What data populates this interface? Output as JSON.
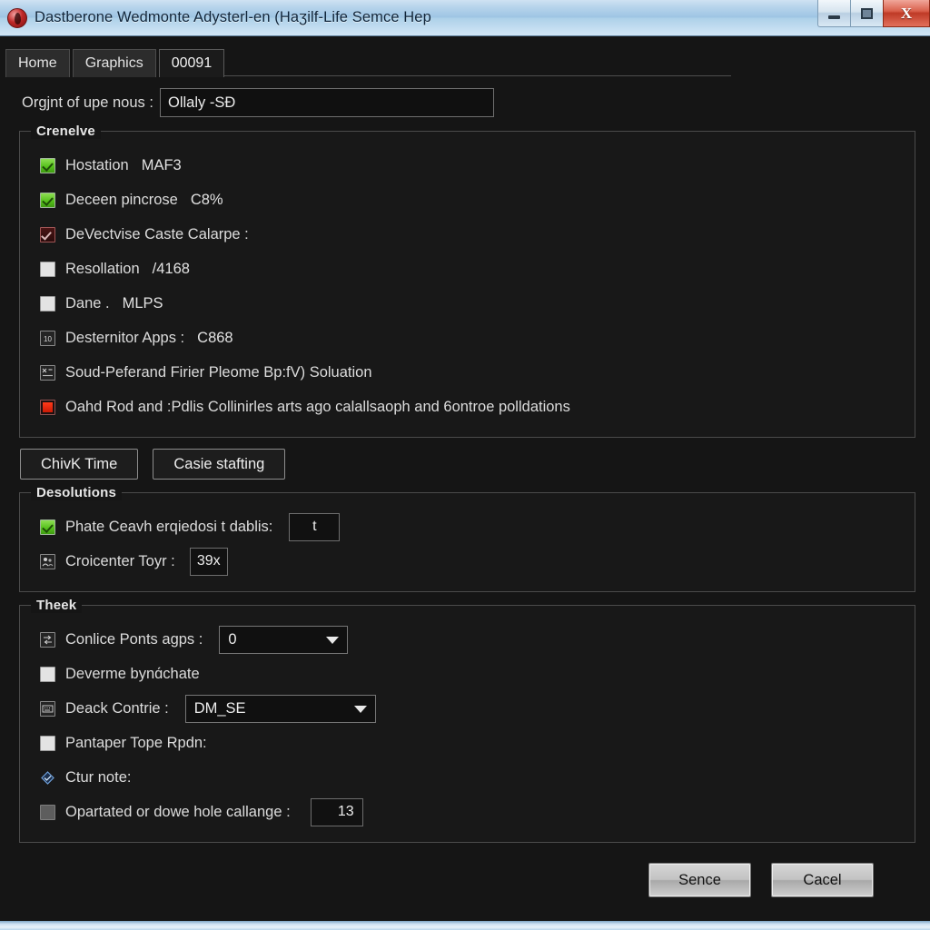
{
  "window": {
    "title": "Dastberone Wedmonte Adysterl-en (Haʒilf-Life Semce Hep",
    "icon": "app-orb-icon",
    "minimize_label": "–",
    "maximize_label": "■",
    "close_label": "X"
  },
  "tabs": [
    {
      "label": "Home",
      "active": false
    },
    {
      "label": "Graphics",
      "active": false
    },
    {
      "label": "00091",
      "active": true
    }
  ],
  "toprow": {
    "label": "Orgjnt of upe nous :",
    "value": "Ollaly -SƉ",
    "placeholder": ""
  },
  "groups": [
    {
      "title": "Crenelve",
      "rows": [
        {
          "icon": "checkbox-checked-green",
          "label": "Hostation",
          "value": "MAF3"
        },
        {
          "icon": "checkbox-checked-green",
          "label": "Deceen pincrose",
          "value": "C8%"
        },
        {
          "icon": "checkbox-checked-red",
          "label": "DeVectvise Caste Calarpe :",
          "value": ""
        },
        {
          "icon": "checkbox-unchecked",
          "label": "Resollation",
          "value": "/4168"
        },
        {
          "icon": "checkbox-unchecked",
          "label": "Dane .",
          "value": "MLPS"
        },
        {
          "icon": "glyph-box-digits",
          "label": "Desternitor Apps :",
          "value": "C868"
        },
        {
          "icon": "glyph-box-chart",
          "label": "Soud-Peferand Firier Pleome Bp:fV) Soluation",
          "value": ""
        },
        {
          "icon": "checkbox-filled-red",
          "label": "Oahd Rod and :Pdlis Collinirles arts ago calallsaoph and 6ontroe polldations",
          "value": ""
        }
      ]
    },
    {
      "title": "Desolutions",
      "rows": [
        {
          "icon": "checkbox-checked-green-small",
          "label": "Phate Ceavh erqiedosi t dablis:",
          "field": "t",
          "field_width": 56
        },
        {
          "icon": "glyph-box-people",
          "label": "Croicenter Toyr :",
          "field": "39x",
          "field_width": 42
        }
      ]
    },
    {
      "title": "Theek",
      "rows": [
        {
          "icon": "glyph-box-swap",
          "label": "Conlice Ponts agps :",
          "select": "0",
          "select_width": 142
        },
        {
          "icon": "checkbox-unchecked",
          "label": "Deverme bynɑ́chate"
        },
        {
          "icon": "glyph-box-keys",
          "label": "Deack Contrie :",
          "select": "DM_SE",
          "select_width": 210
        },
        {
          "icon": "checkbox-unchecked",
          "label": "Pantaper Tope Rpdn:"
        },
        {
          "icon": "diamond-blue",
          "label": "Ctur note:"
        },
        {
          "icon": "checkbox-grey",
          "label": "Opartated or dowe hole callange :",
          "field": "13",
          "field_width": 58
        }
      ]
    }
  ],
  "group_buttons": [
    {
      "label": "ChivK Time"
    },
    {
      "label": "Casie stafting"
    }
  ],
  "footer": {
    "ok_label": "Sence",
    "cancel_label": "Cacel"
  },
  "colors": {
    "titlebar_accent": "#9ec5e4",
    "close_red": "#bf3a26",
    "checkbox_green": "#57c21d",
    "checkbox_red": "#cc1a05",
    "panel_bg": "#181818",
    "window_bg": "#151515"
  }
}
